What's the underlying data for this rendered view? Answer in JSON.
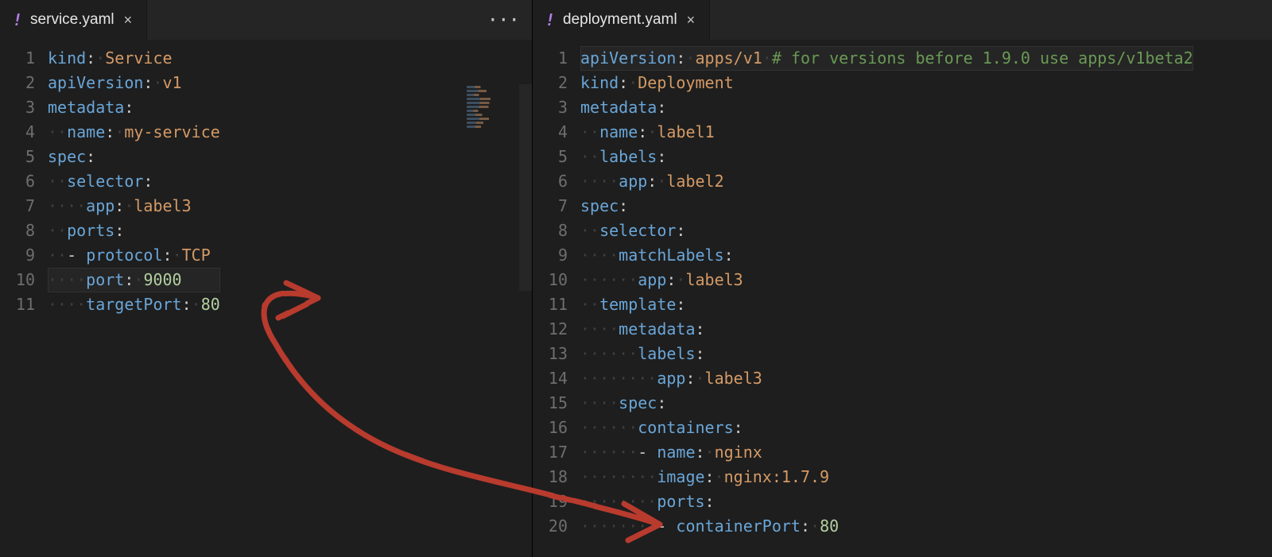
{
  "left": {
    "tab": {
      "icon": "!",
      "title": "service.yaml",
      "close": "×"
    },
    "lineCount": 11,
    "tokens": [
      [
        [
          "key",
          "kind"
        ],
        [
          "pun",
          ":"
        ],
        [
          "ws",
          " "
        ],
        [
          "str",
          "Service"
        ]
      ],
      [
        [
          "key",
          "apiVersion"
        ],
        [
          "pun",
          ":"
        ],
        [
          "ws",
          " "
        ],
        [
          "str",
          "v1"
        ]
      ],
      [
        [
          "key",
          "metadata"
        ],
        [
          "pun",
          ":"
        ]
      ],
      [
        [
          "ws",
          "  "
        ],
        [
          "key",
          "name"
        ],
        [
          "pun",
          ":"
        ],
        [
          "ws",
          " "
        ],
        [
          "str",
          "my-service"
        ]
      ],
      [
        [
          "key",
          "spec"
        ],
        [
          "pun",
          ":"
        ]
      ],
      [
        [
          "ws",
          "  "
        ],
        [
          "key",
          "selector"
        ],
        [
          "pun",
          ":"
        ]
      ],
      [
        [
          "ws",
          "    "
        ],
        [
          "key",
          "app"
        ],
        [
          "pun",
          ":"
        ],
        [
          "ws",
          " "
        ],
        [
          "str",
          "label3"
        ]
      ],
      [
        [
          "ws",
          "  "
        ],
        [
          "key",
          "ports"
        ],
        [
          "pun",
          ":"
        ]
      ],
      [
        [
          "ws",
          "  "
        ],
        [
          "pun",
          "- "
        ],
        [
          "key",
          "protocol"
        ],
        [
          "pun",
          ":"
        ],
        [
          "ws",
          " "
        ],
        [
          "str",
          "TCP"
        ]
      ],
      [
        [
          "ws",
          "    "
        ],
        [
          "key",
          "port"
        ],
        [
          "pun",
          ":"
        ],
        [
          "ws",
          " "
        ],
        [
          "num",
          "9000"
        ]
      ],
      [
        [
          "ws",
          "    "
        ],
        [
          "key",
          "targetPort"
        ],
        [
          "pun",
          ":"
        ],
        [
          "ws",
          " "
        ],
        [
          "num",
          "80"
        ]
      ]
    ],
    "highlightRow": 10
  },
  "right": {
    "tab": {
      "icon": "!",
      "title": "deployment.yaml",
      "close": "×"
    },
    "lineCount": 20,
    "tokens": [
      [
        [
          "key",
          "apiVersion"
        ],
        [
          "pun",
          ":"
        ],
        [
          "ws",
          " "
        ],
        [
          "str",
          "apps/v1"
        ],
        [
          "ws",
          " "
        ],
        [
          "cmt",
          "# for versions before 1.9.0 use apps/v1beta2"
        ]
      ],
      [
        [
          "key",
          "kind"
        ],
        [
          "pun",
          ":"
        ],
        [
          "ws",
          " "
        ],
        [
          "str",
          "Deployment"
        ]
      ],
      [
        [
          "key",
          "metadata"
        ],
        [
          "pun",
          ":"
        ]
      ],
      [
        [
          "ws",
          "  "
        ],
        [
          "key",
          "name"
        ],
        [
          "pun",
          ":"
        ],
        [
          "ws",
          " "
        ],
        [
          "str",
          "label1"
        ]
      ],
      [
        [
          "ws",
          "  "
        ],
        [
          "key",
          "labels"
        ],
        [
          "pun",
          ":"
        ]
      ],
      [
        [
          "ws",
          "    "
        ],
        [
          "key",
          "app"
        ],
        [
          "pun",
          ":"
        ],
        [
          "ws",
          " "
        ],
        [
          "str",
          "label2"
        ]
      ],
      [
        [
          "key",
          "spec"
        ],
        [
          "pun",
          ":"
        ]
      ],
      [
        [
          "ws",
          "  "
        ],
        [
          "key",
          "selector"
        ],
        [
          "pun",
          ":"
        ]
      ],
      [
        [
          "ws",
          "    "
        ],
        [
          "key",
          "matchLabels"
        ],
        [
          "pun",
          ":"
        ]
      ],
      [
        [
          "ws",
          "      "
        ],
        [
          "key",
          "app"
        ],
        [
          "pun",
          ":"
        ],
        [
          "ws",
          " "
        ],
        [
          "str",
          "label3"
        ]
      ],
      [
        [
          "ws",
          "  "
        ],
        [
          "key",
          "template"
        ],
        [
          "pun",
          ":"
        ]
      ],
      [
        [
          "ws",
          "    "
        ],
        [
          "key",
          "metadata"
        ],
        [
          "pun",
          ":"
        ]
      ],
      [
        [
          "ws",
          "      "
        ],
        [
          "key",
          "labels"
        ],
        [
          "pun",
          ":"
        ]
      ],
      [
        [
          "ws",
          "        "
        ],
        [
          "key",
          "app"
        ],
        [
          "pun",
          ":"
        ],
        [
          "ws",
          " "
        ],
        [
          "str",
          "label3"
        ]
      ],
      [
        [
          "ws",
          "    "
        ],
        [
          "key",
          "spec"
        ],
        [
          "pun",
          ":"
        ]
      ],
      [
        [
          "ws",
          "      "
        ],
        [
          "key",
          "containers"
        ],
        [
          "pun",
          ":"
        ]
      ],
      [
        [
          "ws",
          "      "
        ],
        [
          "pun",
          "- "
        ],
        [
          "key",
          "name"
        ],
        [
          "pun",
          ":"
        ],
        [
          "ws",
          " "
        ],
        [
          "str",
          "nginx"
        ]
      ],
      [
        [
          "ws",
          "        "
        ],
        [
          "key",
          "image"
        ],
        [
          "pun",
          ":"
        ],
        [
          "ws",
          " "
        ],
        [
          "str",
          "nginx:1.7.9"
        ]
      ],
      [
        [
          "ws",
          "        "
        ],
        [
          "key",
          "ports"
        ],
        [
          "pun",
          ":"
        ]
      ],
      [
        [
          "ws",
          "        "
        ],
        [
          "pun",
          "- "
        ],
        [
          "key",
          "containerPort"
        ],
        [
          "pun",
          ":"
        ],
        [
          "ws",
          " "
        ],
        [
          "num",
          "80"
        ]
      ]
    ],
    "highlightRow": 1
  },
  "ellipsis": "···",
  "annotation_color": "#b83a2f"
}
